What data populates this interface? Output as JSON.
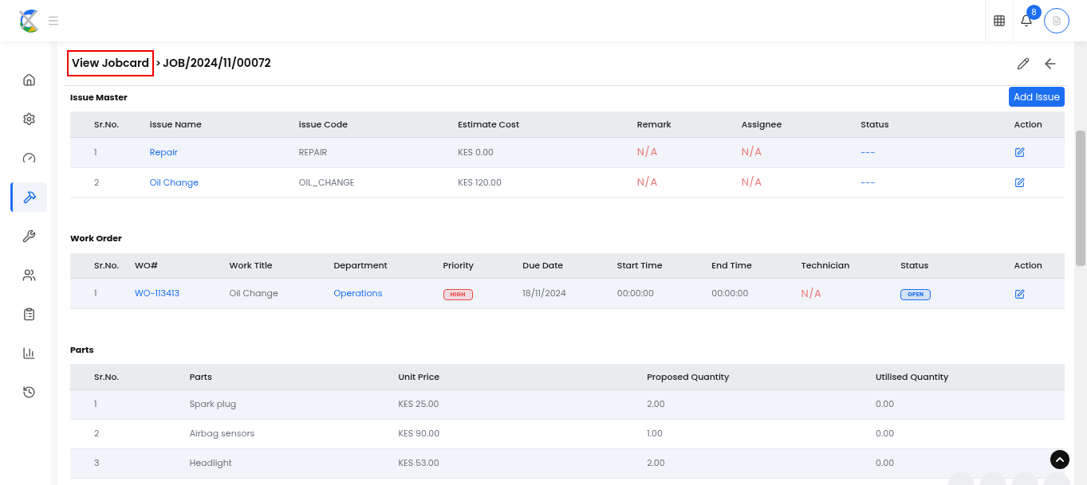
{
  "header": {
    "notification_count": "8"
  },
  "sidebar": {
    "items": [
      {
        "kind": "home",
        "selected": false
      },
      {
        "kind": "settings",
        "selected": false
      },
      {
        "kind": "gauge",
        "selected": false
      },
      {
        "kind": "tools",
        "selected": true
      },
      {
        "kind": "wrench",
        "selected": false
      },
      {
        "kind": "users",
        "selected": false
      },
      {
        "kind": "clipboard",
        "selected": false
      },
      {
        "kind": "chart",
        "selected": false
      },
      {
        "kind": "history",
        "selected": false
      }
    ]
  },
  "breadcrumb": {
    "parent": "View Jobcard",
    "highlighted": true,
    "separator": ">",
    "current": "JOB/2024/11/00072"
  },
  "sections": [
    {
      "title": "Issue Master",
      "button": "Add Issue",
      "columns": [
        "Sr.No.",
        "issue Name",
        "issue Code",
        "Estimate Cost",
        "Remark",
        "Assignee",
        "Status",
        "Action"
      ],
      "rows": [
        [
          {
            "kind": "text",
            "text": "1"
          },
          {
            "kind": "link",
            "text": "Repair"
          },
          {
            "kind": "text",
            "text": "REPAIR"
          },
          {
            "kind": "text",
            "text": "KES 0.00"
          },
          {
            "kind": "na",
            "text": "N/A"
          },
          {
            "kind": "na",
            "text": "N/A"
          },
          {
            "kind": "dash",
            "text": "---"
          },
          {
            "kind": "action"
          }
        ],
        [
          {
            "kind": "text",
            "text": "2"
          },
          {
            "kind": "link",
            "text": "Oil Change"
          },
          {
            "kind": "text",
            "text": "OIL_CHANGE"
          },
          {
            "kind": "text",
            "text": "KES 120.00"
          },
          {
            "kind": "na",
            "text": "N/A"
          },
          {
            "kind": "na",
            "text": "N/A"
          },
          {
            "kind": "dash",
            "text": "---"
          },
          {
            "kind": "action"
          }
        ]
      ]
    },
    {
      "title": "Work Order",
      "columns": [
        "Sr.No.",
        "WO#",
        "Work Title",
        "Department",
        "Priority",
        "Due Date",
        "Start Time",
        "End Time",
        "Technician",
        "Status",
        "Action"
      ],
      "rows": [
        [
          {
            "kind": "text",
            "text": "1"
          },
          {
            "kind": "link",
            "text": "WO-113413"
          },
          {
            "kind": "text",
            "text": "Oil Change"
          },
          {
            "kind": "link",
            "text": "Operations"
          },
          {
            "kind": "badge",
            "text": "HIGH",
            "color": "#ef4444"
          },
          {
            "kind": "text",
            "text": "18/11/2024"
          },
          {
            "kind": "text",
            "text": "00:00:00"
          },
          {
            "kind": "text",
            "text": "00:00:00"
          },
          {
            "kind": "na",
            "text": "N/A"
          },
          {
            "kind": "badge",
            "text": "OPEN",
            "color": "#1d6ff2"
          },
          {
            "kind": "action"
          }
        ]
      ]
    },
    {
      "title": "Parts",
      "columns": [
        "Sr.No.",
        "Parts",
        "Unit Price",
        "Proposed Quantity",
        "Utilised Quantity"
      ],
      "rows": [
        [
          {
            "kind": "text",
            "text": "1"
          },
          {
            "kind": "text",
            "text": "Spark plug"
          },
          {
            "kind": "text",
            "text": "KES 25.00"
          },
          {
            "kind": "text",
            "text": "2.00"
          },
          {
            "kind": "text",
            "text": "0.00"
          }
        ],
        [
          {
            "kind": "text",
            "text": "2"
          },
          {
            "kind": "text",
            "text": "Airbag sensors"
          },
          {
            "kind": "text",
            "text": "KES 90.00"
          },
          {
            "kind": "text",
            "text": "1.00"
          },
          {
            "kind": "text",
            "text": "0.00"
          }
        ],
        [
          {
            "kind": "text",
            "text": "3"
          },
          {
            "kind": "text",
            "text": "Headlight"
          },
          {
            "kind": "text",
            "text": "KES 53.00"
          },
          {
            "kind": "text",
            "text": "2.00"
          },
          {
            "kind": "text",
            "text": "0.00"
          }
        ]
      ]
    }
  ]
}
